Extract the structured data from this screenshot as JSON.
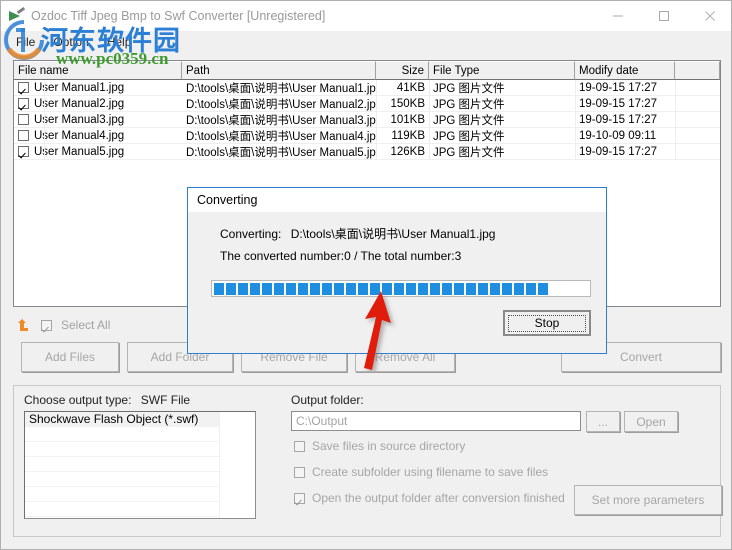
{
  "window": {
    "title": "Ozdoc Tiff Jpeg Bmp to Swf Converter [Unregistered]",
    "minimize_label": "minimize-icon",
    "maximize_label": "maximize-icon",
    "close_label": "close-icon"
  },
  "menu": {
    "items": [
      {
        "label": "File"
      },
      {
        "label": "Option"
      },
      {
        "label": "Help"
      }
    ]
  },
  "watermark": {
    "chinese": "河东软件园",
    "url": "www.pc0359.cn"
  },
  "filelist": {
    "columns": [
      {
        "label": "File name",
        "align": "left"
      },
      {
        "label": "Path",
        "align": "left"
      },
      {
        "label": "Size",
        "align": "right"
      },
      {
        "label": "File Type",
        "align": "left"
      },
      {
        "label": "Modify date",
        "align": "left"
      },
      {
        "label": "",
        "align": "left"
      }
    ],
    "rows": [
      {
        "checked": true,
        "name": "User Manual1.jpg",
        "path": "D:\\tools\\桌面\\说明书\\User Manual1.jpg",
        "size": "41KB",
        "type": "JPG 图片文件",
        "date": "19-09-15 17:27"
      },
      {
        "checked": true,
        "name": "User Manual2.jpg",
        "path": "D:\\tools\\桌面\\说明书\\User Manual2.jpg",
        "size": "150KB",
        "type": "JPG 图片文件",
        "date": "19-09-15 17:27"
      },
      {
        "checked": false,
        "name": "User Manual3.jpg",
        "path": "D:\\tools\\桌面\\说明书\\User Manual3.jpg",
        "size": "101KB",
        "type": "JPG 图片文件",
        "date": "19-09-15 17:27"
      },
      {
        "checked": false,
        "name": "User Manual4.jpg",
        "path": "D:\\tools\\桌面\\说明书\\User Manual4.jpg",
        "size": "119KB",
        "type": "JPG 图片文件",
        "date": "19-10-09 09:11"
      },
      {
        "checked": true,
        "name": "User Manual5.jpg",
        "path": "D:\\tools\\桌面\\说明书\\User Manual5.jpg",
        "size": "126KB",
        "type": "JPG 图片文件",
        "date": "19-09-15 17:27"
      }
    ]
  },
  "toolbar": {
    "select_all_label": "Select All",
    "select_all_checked": true,
    "buttons": [
      {
        "label": "Add Files",
        "enabled": false
      },
      {
        "label": "Add Folder",
        "enabled": false
      },
      {
        "label": "Remove File",
        "enabled": false
      },
      {
        "label": "Remove All",
        "enabled": false
      },
      {
        "label": "Convert",
        "enabled": false
      }
    ]
  },
  "output": {
    "type_label": "Choose output type:",
    "type_value": "SWF File",
    "type_options": [
      "Shockwave Flash Object (*.swf)"
    ],
    "folder_label": "Output folder:",
    "folder_value": "C:\\Output",
    "browse_label": "...",
    "open_label": "Open",
    "options": [
      {
        "label": "Save files in source directory",
        "checked": false
      },
      {
        "label": "Create subfolder using filename to save files",
        "checked": false
      },
      {
        "label": "Open the output folder after conversion finished",
        "checked": true
      }
    ],
    "set_more_label": "Set more parameters"
  },
  "dialog": {
    "title": "Converting",
    "converting_label": "Converting:",
    "converting_file": "D:\\tools\\桌面\\说明书\\User Manual1.jpg",
    "counter_text": "The converted number:0  /  The total number:3",
    "converted_number": 0,
    "total_number": 3,
    "progress_percent": 90,
    "stop_label": "Stop"
  },
  "colors": {
    "accent": "#1e8fe0",
    "dialog_border": "#2a7fd4",
    "watermark_blue": "#2b7fd4",
    "watermark_green": "#3f9a2e",
    "arrow_red": "#e01b10",
    "disabled_text": "#a6a6a6"
  }
}
